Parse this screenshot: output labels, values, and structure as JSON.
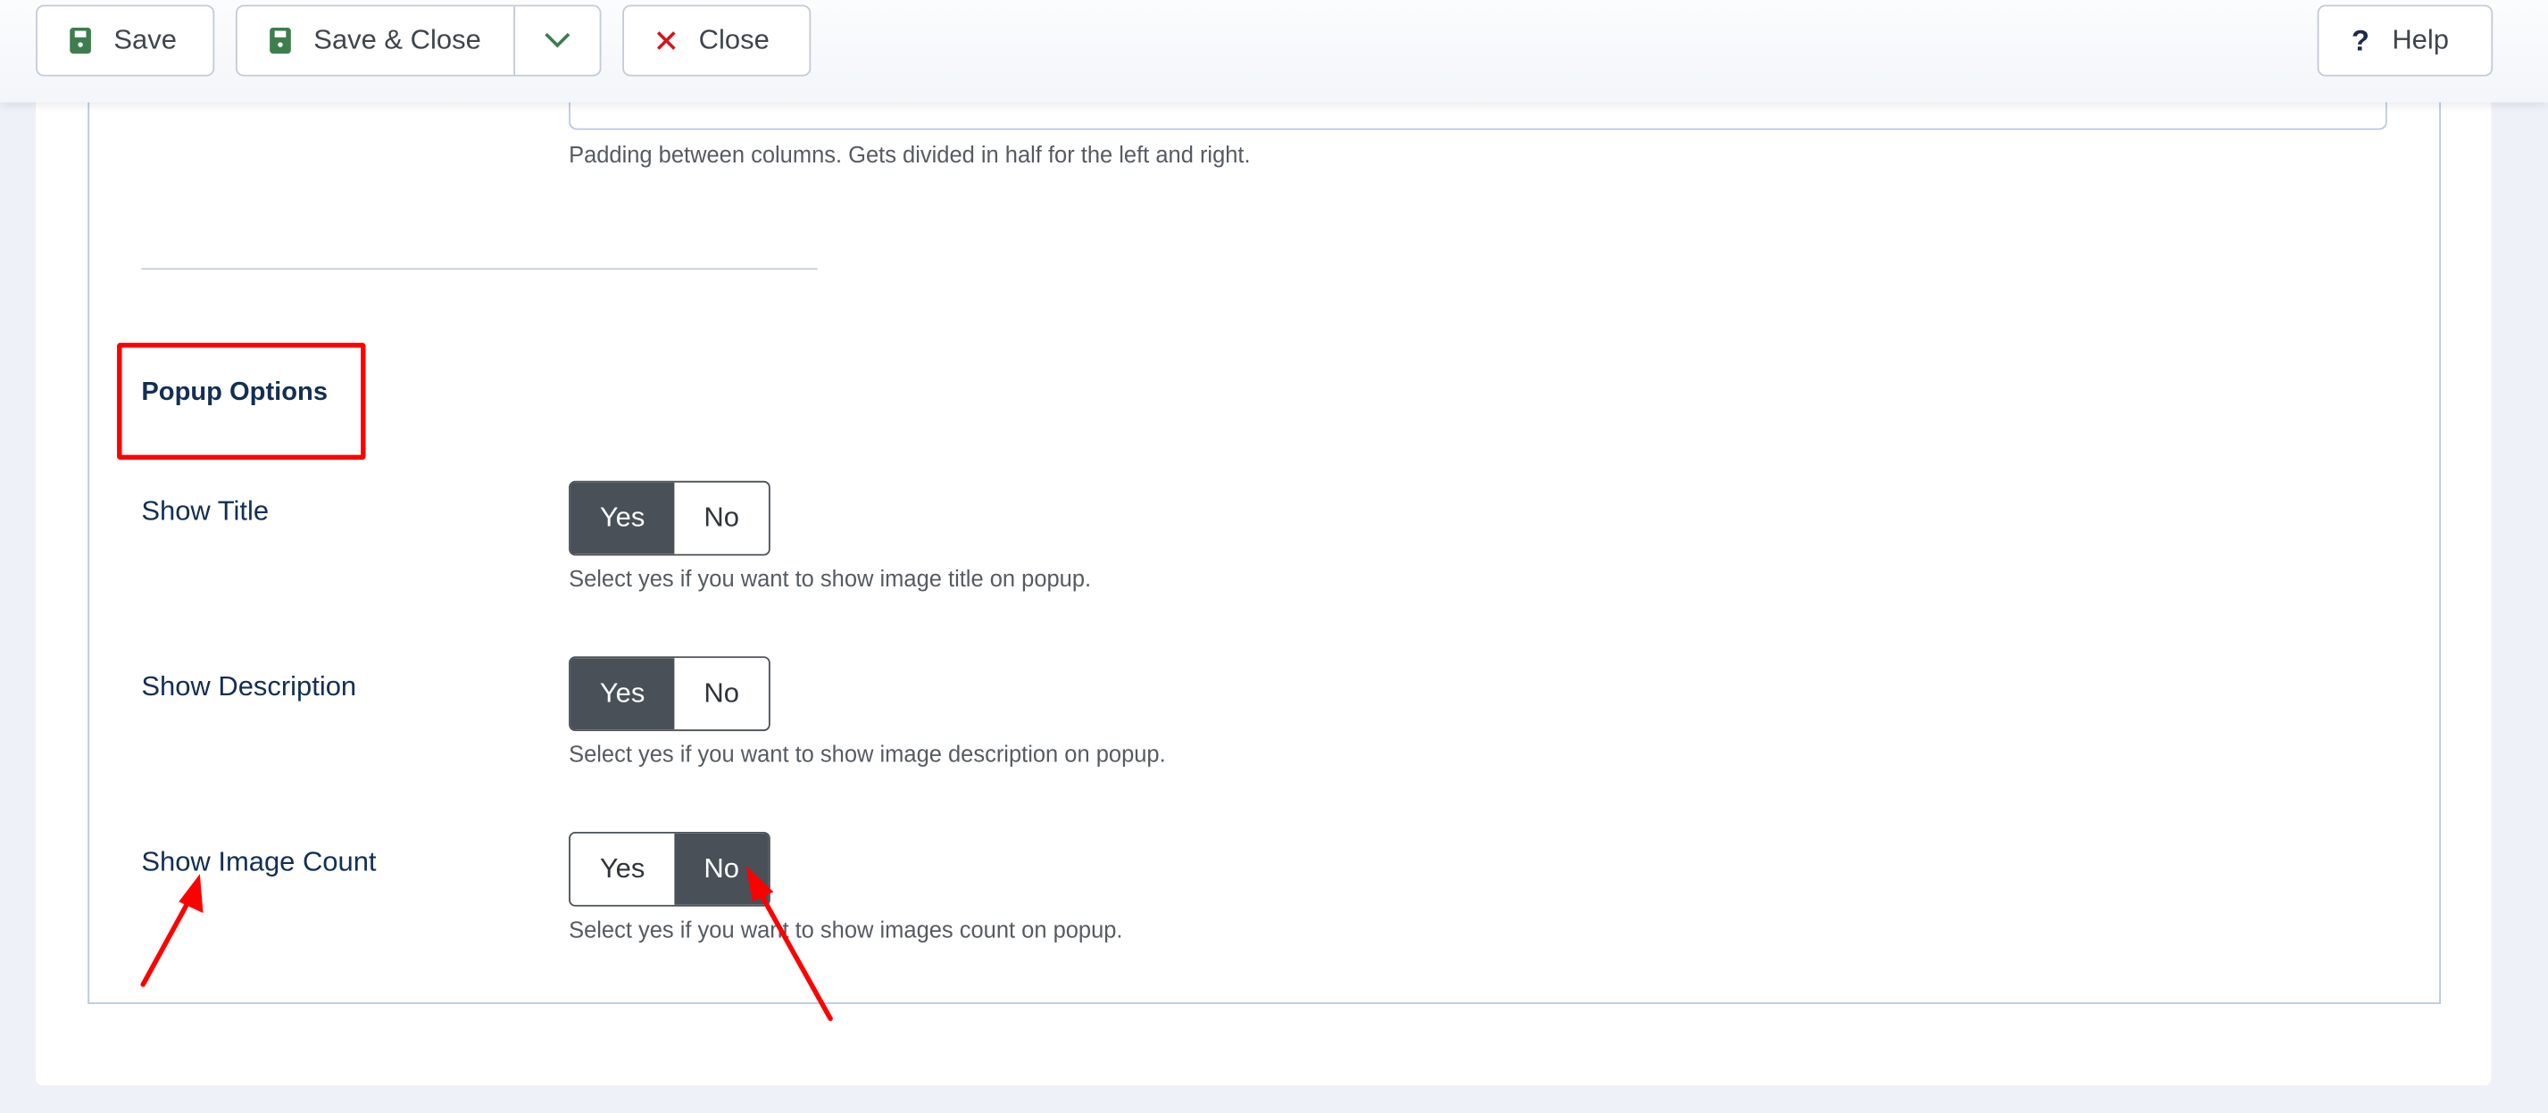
{
  "toolbar": {
    "save": "Save",
    "save_close": "Save & Close",
    "close": "Close",
    "help": "Help"
  },
  "colors": {
    "save_icon": "#3e7d4e",
    "close_icon": "#d0191f",
    "toggle_active": "#495057",
    "annotation": "#ff0000"
  },
  "padding_field": {
    "help": "Padding between columns. Gets divided in half for the left and right."
  },
  "section": {
    "heading": "Popup Options"
  },
  "rows": [
    {
      "label": "Show Title",
      "yes": "Yes",
      "no": "No",
      "selected": "Yes",
      "help": "Select yes if you want to show image title on popup."
    },
    {
      "label": "Show Description",
      "yes": "Yes",
      "no": "No",
      "selected": "Yes",
      "help": "Select yes if you want to show image description on popup."
    },
    {
      "label": "Show Image Count",
      "yes": "Yes",
      "no": "No",
      "selected": "No",
      "help": "Select yes if you want to show images count on popup."
    }
  ]
}
